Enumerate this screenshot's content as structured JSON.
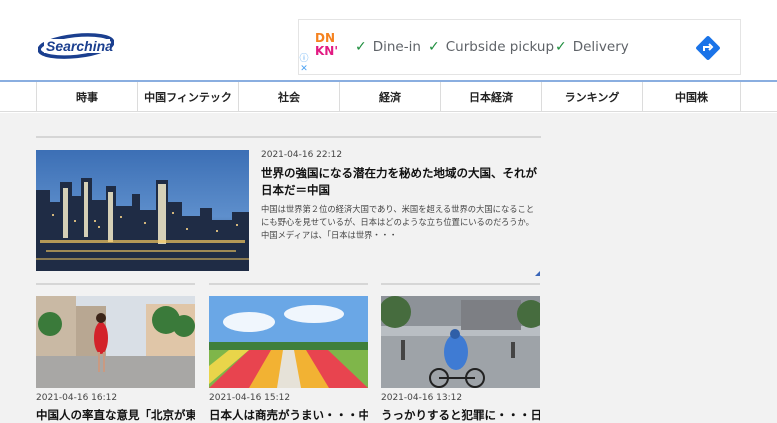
{
  "header": {
    "logo_text": "Searchina"
  },
  "ad": {
    "brand_line1": "DN",
    "brand_line2": "KN'",
    "items": [
      "Dine-in",
      "Curbside pickup",
      "Delivery"
    ],
    "info_icon": "info-icon",
    "close_icon": "close-icon",
    "go_icon": "directions-icon",
    "colors": {
      "check": "#1e8e3e",
      "go": "#1a73e8"
    }
  },
  "nav": {
    "items": [
      "時事",
      "中国フィンテック",
      "社会",
      "経済",
      "日本経済",
      "ランキング",
      "中国株"
    ]
  },
  "feature": {
    "date": "2021-04-16 22:12",
    "title": "世界の強国になる潜在力を秘めた地域の大国、それが日本だ＝中国",
    "body": "中国は世界第２位の経済大国であり、米国を超える世界の大国になることにも野心を見せているが、日本はどのような立ち位置にいるのだろうか。中国メディアは、「日本は世界・・・"
  },
  "cards": [
    {
      "date": "2021-04-16 16:12",
      "title": "中国人の率直な意見「北京が東"
    },
    {
      "date": "2021-04-16 15:12",
      "title": "日本人は商売がうまい・・・中"
    },
    {
      "date": "2021-04-16 13:12",
      "title": "うっかりすると犯罪に・・・日"
    }
  ]
}
